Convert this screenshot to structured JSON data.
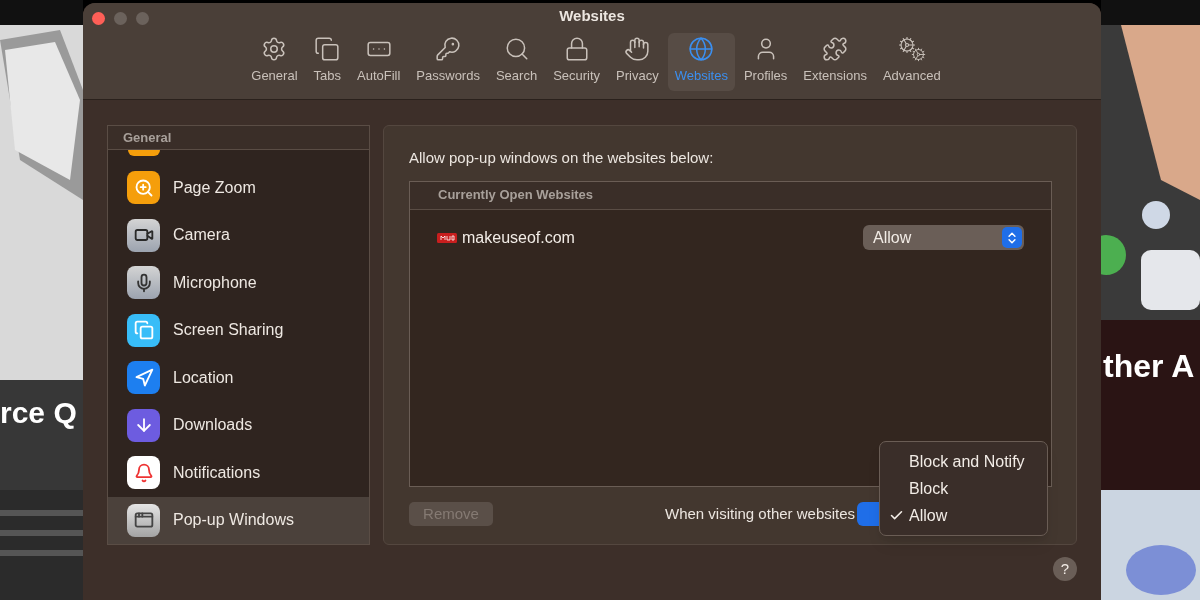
{
  "background": {
    "left_text": "rce Q",
    "right_text": "ther A"
  },
  "window": {
    "title": "Websites"
  },
  "toolbar": {
    "tabs": [
      {
        "label": "General",
        "selected": false
      },
      {
        "label": "Tabs",
        "selected": false
      },
      {
        "label": "AutoFill",
        "selected": false
      },
      {
        "label": "Passwords",
        "selected": false
      },
      {
        "label": "Search",
        "selected": false
      },
      {
        "label": "Security",
        "selected": false
      },
      {
        "label": "Privacy",
        "selected": false
      },
      {
        "label": "Websites",
        "selected": true
      },
      {
        "label": "Profiles",
        "selected": false
      },
      {
        "label": "Extensions",
        "selected": false
      },
      {
        "label": "Advanced",
        "selected": false
      }
    ]
  },
  "sidebar": {
    "header": "General",
    "items": [
      {
        "label": "Page Zoom",
        "selected": false
      },
      {
        "label": "Camera",
        "selected": false
      },
      {
        "label": "Microphone",
        "selected": false
      },
      {
        "label": "Screen Sharing",
        "selected": false
      },
      {
        "label": "Location",
        "selected": false
      },
      {
        "label": "Downloads",
        "selected": false
      },
      {
        "label": "Notifications",
        "selected": false
      },
      {
        "label": "Pop-up Windows",
        "selected": true
      }
    ]
  },
  "panel": {
    "caption": "Allow pop-up windows on the websites below:",
    "table": {
      "header": "Currently Open Websites",
      "rows": [
        {
          "site": "makeuseof.com",
          "setting": "Allow"
        }
      ]
    },
    "remove_button": {
      "label": "Remove",
      "disabled": true
    },
    "other_websites_label": "When visiting other websites",
    "menu": [
      {
        "label": "Block and Notify",
        "checked": false
      },
      {
        "label": "Block",
        "checked": false
      },
      {
        "label": "Allow",
        "checked": true
      }
    ]
  },
  "help_button": "?"
}
